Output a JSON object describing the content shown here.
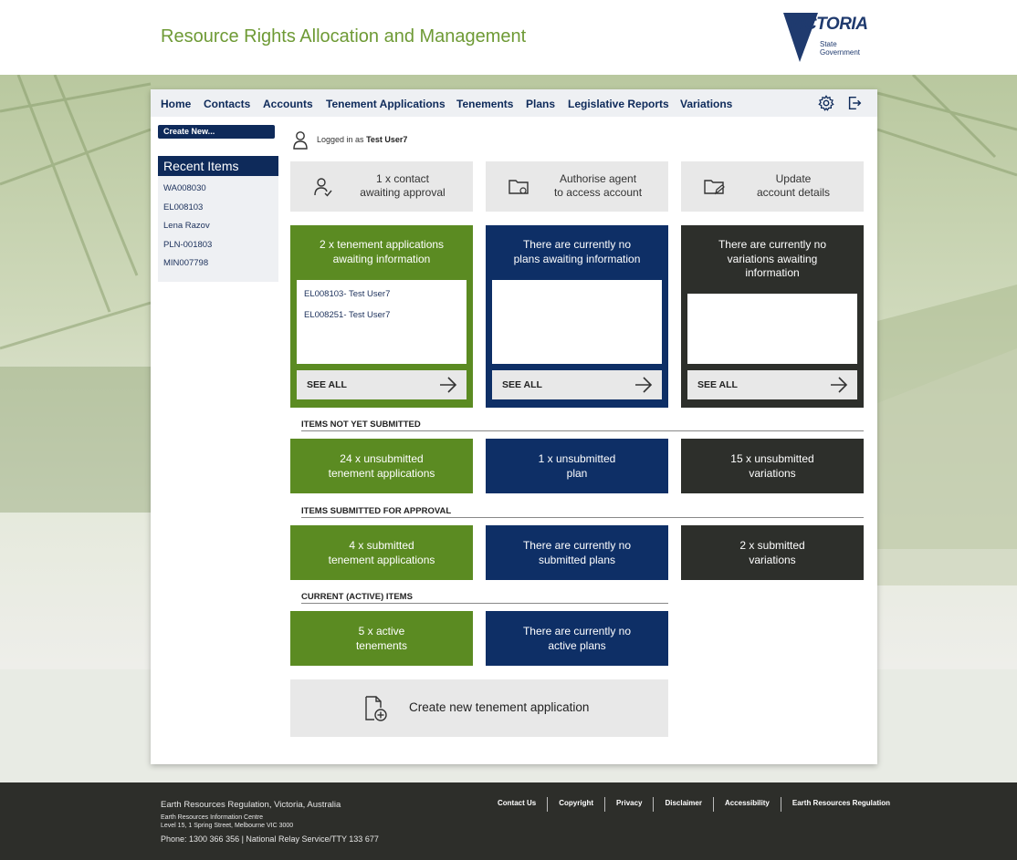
{
  "header": {
    "app_title": "Resource Rights Allocation and Management",
    "logo_word": "VICTORIA",
    "logo_sub_1": "State",
    "logo_sub_2": "Government"
  },
  "nav": {
    "items": [
      "Home",
      "Contacts",
      "Accounts",
      "Tenement Applications",
      "Tenements",
      "Plans",
      "Legislative Reports",
      "Variations"
    ],
    "settings_icon": "gear-icon",
    "logout_icon": "logout-icon"
  },
  "sidebar": {
    "create_new": "Create New...",
    "recent_title": "Recent Items",
    "recent_items": [
      "WA008030",
      "EL008103",
      "Lena Razov",
      "PLN-001803",
      "MIN007798"
    ]
  },
  "user": {
    "logged_prefix": "Logged in as",
    "name": "Test User7"
  },
  "quick_actions": [
    {
      "line1": "1 x contact",
      "line2": "awaiting approval",
      "icon": "user-approval-icon"
    },
    {
      "line1": "Authorise agent",
      "line2": "to access account",
      "icon": "folder-key-icon"
    },
    {
      "line1": "Update",
      "line2": "account details",
      "icon": "folder-edit-icon"
    }
  ],
  "awaiting": [
    {
      "title1": "2 x tenement applications",
      "title2": "awaiting information",
      "title3": "",
      "entries": [
        "EL008103- Test User7",
        "EL008251- Test User7"
      ],
      "see_all": "SEE ALL"
    },
    {
      "title1": "There are currently no",
      "title2": "plans awaiting information",
      "title3": "",
      "entries": [],
      "see_all": "SEE ALL"
    },
    {
      "title1": "There are currently no",
      "title2": "variations awaiting",
      "title3": "information",
      "entries": [],
      "see_all": "SEE ALL"
    }
  ],
  "sections": {
    "not_submitted": {
      "heading": "ITEMS NOT YET SUBMITTED",
      "tiles": [
        {
          "line1": "24 x unsubmitted",
          "line2": "tenement applications"
        },
        {
          "line1": "1 x unsubmitted",
          "line2": "plan"
        },
        {
          "line1": "15 x unsubmitted",
          "line2": "variations"
        }
      ]
    },
    "submitted": {
      "heading": "ITEMS SUBMITTED FOR APPROVAL",
      "tiles": [
        {
          "line1": "4 x submitted",
          "line2": "tenement applications"
        },
        {
          "line1": "There are currently no",
          "line2": "submitted plans"
        },
        {
          "line1": "2 x submitted",
          "line2": "variations"
        }
      ]
    },
    "active": {
      "heading": "CURRENT (ACTIVE) ITEMS",
      "tiles": [
        {
          "line1": "5 x active",
          "line2": "tenements"
        },
        {
          "line1": "There are currently no",
          "line2": "active plans"
        }
      ]
    }
  },
  "create_application": "Create new tenement application",
  "footer": {
    "org": "Earth Resources Regulation, Victoria, Australia",
    "centre": "Earth Resources Information Centre",
    "address": "Level 15, 1 Spring Street, Melbourne VIC 3000",
    "phone": "Phone: 1300 366 356 | National Relay Service/TTY 133 677",
    "links": [
      "Contact Us",
      "Copyright",
      "Privacy",
      "Disclaimer",
      "Accessibility",
      "Earth Resources Regulation"
    ]
  },
  "colors": {
    "green": "#5b8b22",
    "blue": "#0e2f66",
    "dark": "#2d2f2b",
    "title_green": "#6e9a35"
  }
}
